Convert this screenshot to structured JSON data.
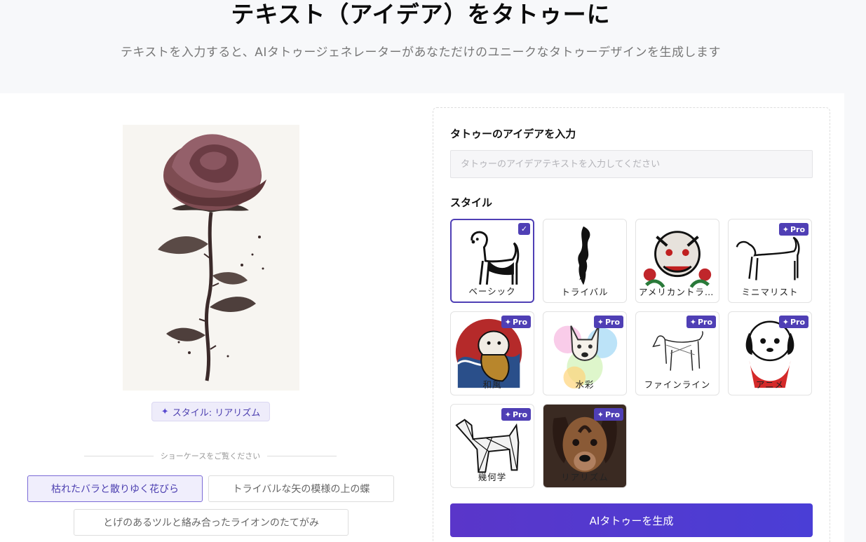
{
  "hero": {
    "title": "テキスト（アイデア）をタトゥーに",
    "subtitle": "テキストを入力すると、AIタトゥージェネレーターがあなただけのユニークなタトゥーデザインを生成します"
  },
  "showcase": {
    "style_badge": "スタイル: リアリズム",
    "section_label": "ショーケースをご覧ください",
    "chips": [
      {
        "label": "枯れたバラと散りゆく花びら",
        "active": true
      },
      {
        "label": "トライバルな矢の模様の上の蝶",
        "active": false
      },
      {
        "label": "とげのあるツルと絡み合ったライオンのたてがみ",
        "active": false
      }
    ]
  },
  "form": {
    "idea_label": "タトゥーのアイデアを入力",
    "idea_placeholder": "タトゥーのアイデアテキストを入力してください",
    "idea_value": "",
    "style_label": "スタイル",
    "pro_label": "Pro",
    "styles": [
      {
        "name": "ベーシック",
        "pro": false,
        "selected": true
      },
      {
        "name": "トライバル",
        "pro": false,
        "selected": false
      },
      {
        "name": "アメリカントラディショナル",
        "pro": false,
        "selected": false
      },
      {
        "name": "ミニマリスト",
        "pro": true,
        "selected": false
      },
      {
        "name": "和風",
        "pro": true,
        "selected": false
      },
      {
        "name": "水彩",
        "pro": true,
        "selected": false
      },
      {
        "name": "ファインライン",
        "pro": true,
        "selected": false
      },
      {
        "name": "アニメ",
        "pro": true,
        "selected": false
      },
      {
        "name": "幾何学",
        "pro": true,
        "selected": false
      },
      {
        "name": "リアリズム",
        "pro": true,
        "selected": false
      }
    ],
    "generate_button": "AIタトゥーを生成"
  },
  "colors": {
    "accent": "#4f3fb5",
    "accent_light": "#f0eefc",
    "hero_bg": "#f7f8fa"
  }
}
